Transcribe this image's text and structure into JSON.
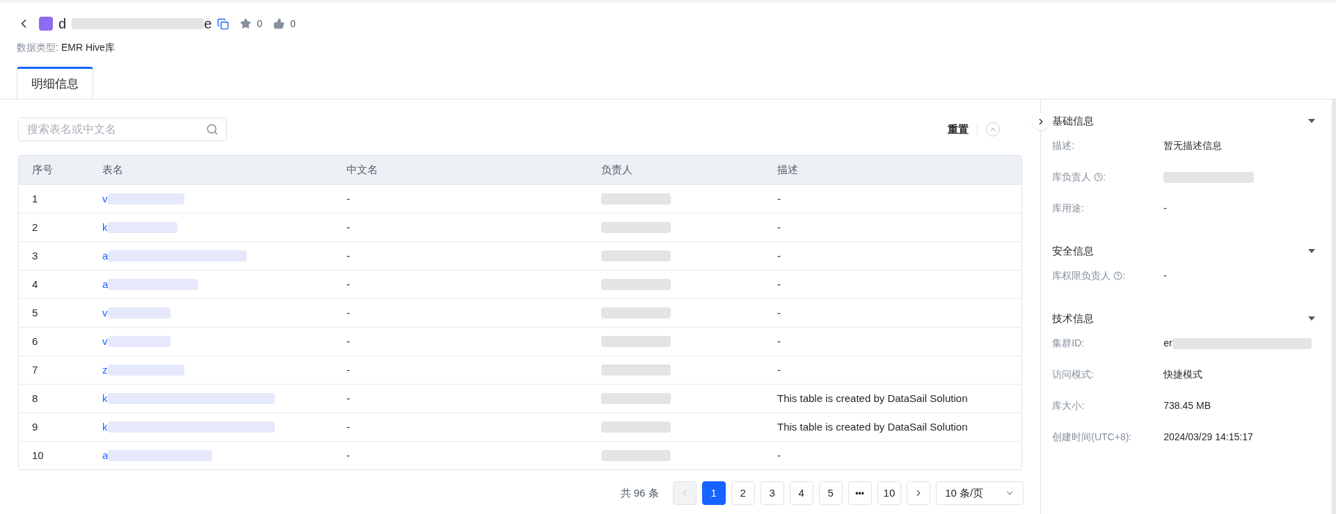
{
  "header": {
    "title_start": "d",
    "title_end": "e",
    "stars": "0",
    "likes": "0",
    "data_type_label": "数据类型:",
    "data_type_value": "EMR Hive库"
  },
  "tabs": [
    {
      "label": "明细信息",
      "selected": true
    }
  ],
  "search": {
    "placeholder": "搜索表名或中文名"
  },
  "reset": "重置",
  "table": {
    "columns": [
      "序号",
      "表名",
      "中文名",
      "负责人",
      "描述"
    ],
    "rows": [
      {
        "index": "1",
        "name": "v",
        "cn_name": "-",
        "description": "-"
      },
      {
        "index": "2",
        "name": "k",
        "cn_name": "-",
        "description": "-"
      },
      {
        "index": "3",
        "name": "a",
        "cn_name": "-",
        "description": "-"
      },
      {
        "index": "4",
        "name": "a",
        "cn_name": "-",
        "description": "-"
      },
      {
        "index": "5",
        "name": "v",
        "cn_name": "-",
        "description": "-"
      },
      {
        "index": "6",
        "name": "v",
        "cn_name": "-",
        "description": "-"
      },
      {
        "index": "7",
        "name": "z",
        "cn_name": "-",
        "description": "-"
      },
      {
        "index": "8",
        "name": "k",
        "cn_name": "-",
        "description": "This table is created by DataSail Solution"
      },
      {
        "index": "9",
        "name": "k",
        "cn_name": "-",
        "description": "This table is created by DataSail Solution"
      },
      {
        "index": "10",
        "name": "a",
        "cn_name": "-",
        "description": "-"
      }
    ]
  },
  "pagination": {
    "total": "共 96 条",
    "prev_disabled": true,
    "pages": [
      {
        "label": "1",
        "kind": "page",
        "selected": true
      },
      {
        "label": "2",
        "kind": "page",
        "selected": false
      },
      {
        "label": "3",
        "kind": "page",
        "selected": false
      },
      {
        "label": "4",
        "kind": "page",
        "selected": false
      },
      {
        "label": "5",
        "kind": "page",
        "selected": false
      },
      {
        "label": "•••",
        "kind": "ellipsis",
        "selected": false
      },
      {
        "label": "10",
        "kind": "page",
        "selected": false
      }
    ],
    "page_size": "10 条/页"
  },
  "sidebar": {
    "sections": [
      {
        "title": "基础信息",
        "expanded": true,
        "fields": [
          {
            "label": "描述:",
            "value": "暂无描述信息",
            "help": false,
            "kind": "text"
          },
          {
            "label": "库负责人",
            "help": true,
            "suffix": ":",
            "kind": "redacted"
          },
          {
            "label": "库用途:",
            "value": "-",
            "help": false,
            "kind": "text"
          }
        ]
      },
      {
        "title": "安全信息",
        "expanded": true,
        "fields": [
          {
            "label": "库权限负责人",
            "help": true,
            "suffix": ":",
            "value": "-",
            "kind": "text"
          }
        ]
      },
      {
        "title": "技术信息",
        "expanded": true,
        "fields": [
          {
            "label": "集群ID:",
            "value": "er",
            "help": false,
            "kind": "partial"
          },
          {
            "label": "访问模式:",
            "value": "快捷模式",
            "help": false,
            "kind": "text"
          },
          {
            "label": "库大小:",
            "value": "738.45 MB",
            "help": false,
            "kind": "text"
          },
          {
            "label": "创建时间(UTC+8):",
            "value": "2024/03/29 14:15:17",
            "help": false,
            "kind": "text"
          }
        ]
      }
    ]
  }
}
